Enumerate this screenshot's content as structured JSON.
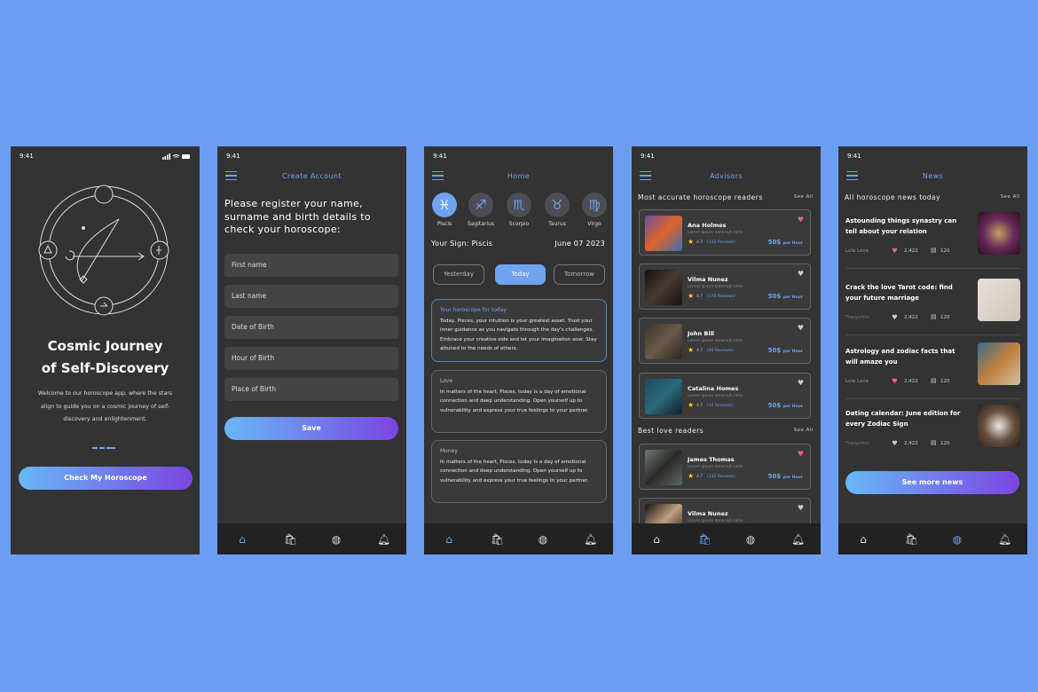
{
  "colors": {
    "background": "#6b9ef1",
    "phone": "#333333",
    "accent": "#6fa3f0",
    "gradient_start": "#68b8f6",
    "gradient_end": "#7b45e2",
    "heart_active": "#f0608a",
    "star": "#f6d21b"
  },
  "status_time": "9:41",
  "onboarding": {
    "title_line1": "Cosmic Journey",
    "title_line2": "of Self-Discovery",
    "description": "Welcome to our horoscope app, where the stars align to guide you on a cosmic journey of self-discovery and enlightenment.",
    "button": "Check My Horoscope",
    "icon": "zodiac-wheel-sagittarius-illustration"
  },
  "create_account": {
    "title": "Create Account",
    "heading": "Please register your name, surname and birth details to check your horoscope:",
    "fields": [
      {
        "placeholder": "First name"
      },
      {
        "placeholder": "Last name"
      },
      {
        "placeholder": "Date of Birth"
      },
      {
        "placeholder": "Hour of Birth"
      },
      {
        "placeholder": "Place of Birth"
      }
    ],
    "button": "Save"
  },
  "home": {
    "title": "Home",
    "signs": [
      {
        "glyph": "♓︎",
        "label": "Piscis",
        "selected": true
      },
      {
        "glyph": "♐︎",
        "label": "Sagitarius"
      },
      {
        "glyph": "♏︎",
        "label": "Scorpio"
      },
      {
        "glyph": "♉︎",
        "label": "Taurus"
      },
      {
        "glyph": "♍︎",
        "label": "Virgo"
      }
    ],
    "your_sign": "Your Sign: Piscis",
    "date": "June 07 2023",
    "tabs": [
      {
        "label": "Yesterday"
      },
      {
        "label": "Today",
        "active": true
      },
      {
        "label": "Tomorrow"
      }
    ],
    "cards": [
      {
        "heading": "Your horoscope for today",
        "body": "Today, Pisces, your intuition is your greatest asset. Trust your inner guidance as you navigate through the day's challenges. Embrace your creative side and let your imagination soar. Stay attuned to the needs of others."
      },
      {
        "heading": "Love",
        "body": "In matters of the heart, Pisces, today is a day of emotional connection and deep understanding. Open yourself up to vulnerability and express your true feelings to your partner."
      },
      {
        "heading": "Money",
        "body": "In matters of the heart, Pisces, today is a day of emotional connection and deep understanding. Open yourself up to vulnerability and express your true feelings to your partner."
      }
    ]
  },
  "advisors": {
    "title": "Advisors",
    "section1": "Most accurate horoscope readers",
    "section2": "Best love readers",
    "see_all": "See All",
    "items": [
      {
        "name": "Ana Holmes",
        "desc": "Lorem ipsum lomerujh kkhk",
        "rating": "4.7",
        "reviews": "(132 Reviews)",
        "price": "50$",
        "unit": "per Hour",
        "favorite": true
      },
      {
        "name": "Vilma Nunez",
        "desc": "Lorem ipsum lomerujh kkhk",
        "rating": "4.7",
        "reviews": "(170 Reviews)",
        "price": "50$",
        "unit": "per Hour",
        "favorite": false
      },
      {
        "name": "John Bill",
        "desc": "Lorem ipsum lomerujh kkhk",
        "rating": "4.7",
        "reviews": "(40 Reviews)",
        "price": "50$",
        "unit": "per Hour",
        "favorite": false
      },
      {
        "name": "Catalina Homes",
        "desc": "Lorem ipsum lomerujh kkhk",
        "rating": "4.7",
        "reviews": "(12 Reviews)",
        "price": "50$",
        "unit": "per Hour",
        "favorite": false
      },
      {
        "name": "James Thomas",
        "desc": "Lorem ipsum lomerujh kkhk",
        "rating": "4.7",
        "reviews": "(132 Reviews)",
        "price": "50$",
        "unit": "per Hour",
        "favorite": true
      },
      {
        "name": "Vilma Nunez",
        "desc": "Lorem ipsum lomerujh kkhk",
        "rating": "",
        "reviews": "",
        "price": "",
        "unit": "",
        "favorite": false
      }
    ]
  },
  "news": {
    "title": "News",
    "section": "All horoscope news today",
    "see_all": "See All",
    "items": [
      {
        "title": "Astounding things synastry can tell about your relation",
        "author": "Lola Love",
        "likes": "2,422",
        "comments": "120",
        "liked": true
      },
      {
        "title": "Crack the love Tarot code: find your future marriage",
        "author": "Trasyomic",
        "likes": "2,422",
        "comments": "120",
        "liked": false
      },
      {
        "title": "Astrology and zodiac facts that will amaze you",
        "author": "Lola Love",
        "likes": "2,422",
        "comments": "120",
        "liked": true
      },
      {
        "title": "Dating calendar: June edition for every Zodiac Sign",
        "author": "Trasyomic",
        "likes": "2,422",
        "comments": "120",
        "liked": false
      }
    ],
    "button": "See more news"
  },
  "nav": [
    {
      "icon": "home-icon"
    },
    {
      "icon": "bag-icon"
    },
    {
      "icon": "globe-icon"
    },
    {
      "icon": "bell-icon"
    }
  ]
}
